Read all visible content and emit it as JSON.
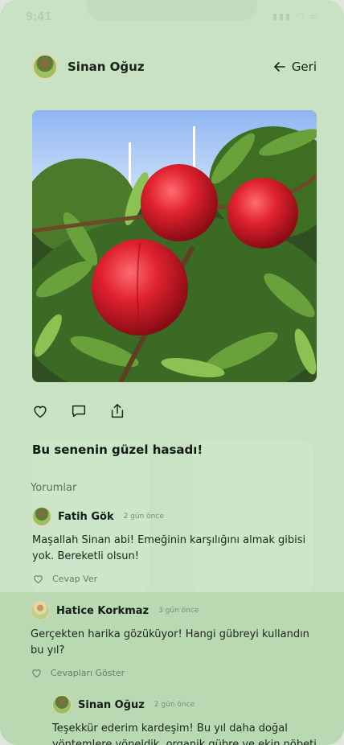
{
  "status_bar": {
    "time": "9:41",
    "icons": "▮▮▮ ◠ ▭"
  },
  "header": {
    "user_name": "Sinan Oğuz",
    "back_label": "Geri"
  },
  "post": {
    "caption": "Bu senenin güzel hasadı!",
    "actions": [
      "heart-icon",
      "comment-icon",
      "share-icon"
    ]
  },
  "comments": {
    "title": "Yorumlar",
    "items": [
      {
        "name": "Fatih Gök",
        "time": "2 gün önce",
        "text": "Maşallah Sinan abi! Emeğinin karşılığını almak gibisi yok. Bereketli olsun!",
        "action": "Cevap Ver"
      },
      {
        "name": "Hatice Korkmaz",
        "time": "3 gün önce",
        "text": "Gerçekten harika gözüküyor! Hangi gübreyi kullandın bu yıl?",
        "action": "Cevapları Göster"
      },
      {
        "name": "Sinan Oğuz",
        "time": "2 gün önce",
        "text": "Teşekkür ederim kardeşim! Bu yıl daha doğal yöntemlere yöneldik, organik gübre ve ekin nöbeti uyguladık. Verim"
      }
    ]
  },
  "colors": {
    "background": "#c8e2c3",
    "highlight_band": "#b9d9b3",
    "text": "#172217"
  }
}
